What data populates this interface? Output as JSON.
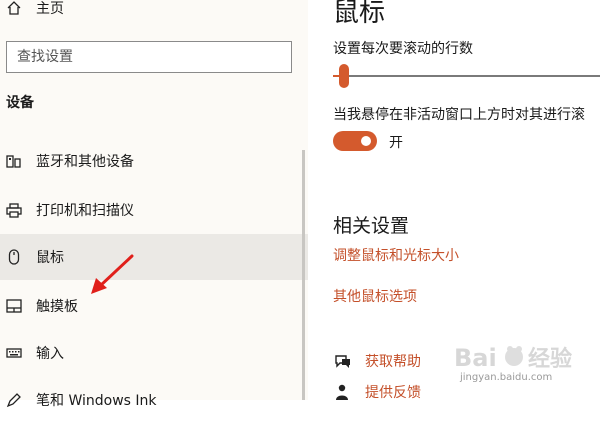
{
  "sidebar": {
    "home_label": "主页",
    "search_placeholder": "查找设置",
    "section_label": "设备",
    "items": [
      {
        "label": "蓝牙和其他设备",
        "icon": "devices-icon"
      },
      {
        "label": "打印机和扫描仪",
        "icon": "printer-icon"
      },
      {
        "label": "鼠标",
        "icon": "mouse-icon",
        "selected": true
      },
      {
        "label": "触摸板",
        "icon": "touchpad-icon"
      },
      {
        "label": "输入",
        "icon": "keyboard-icon"
      },
      {
        "label": "笔和 Windows Ink",
        "icon": "pen-icon"
      }
    ]
  },
  "main": {
    "title": "鼠标",
    "scroll_lines_label": "设置每次要滚动的行数",
    "scroll_lines_value": 0.04,
    "hover_scroll_label": "当我悬停在非活动窗口上方时对其进行滚",
    "hover_scroll_enabled": true,
    "hover_scroll_state": "开",
    "related_title": "相关设置",
    "links": [
      "调整鼠标和光标大小",
      "其他鼠标选项"
    ],
    "help": [
      {
        "label": "获取帮助",
        "icon": "help-chat-icon"
      },
      {
        "label": "提供反馈",
        "icon": "feedback-icon"
      }
    ]
  },
  "colors": {
    "accent": "#d45a2d",
    "link": "#c4502a",
    "sidebar_bg": "#fcfaf6",
    "selected_bg": "#ebe9e5",
    "annotation_arrow": "#e0201b"
  },
  "watermark": {
    "text": "jingyan.baidu.com"
  }
}
